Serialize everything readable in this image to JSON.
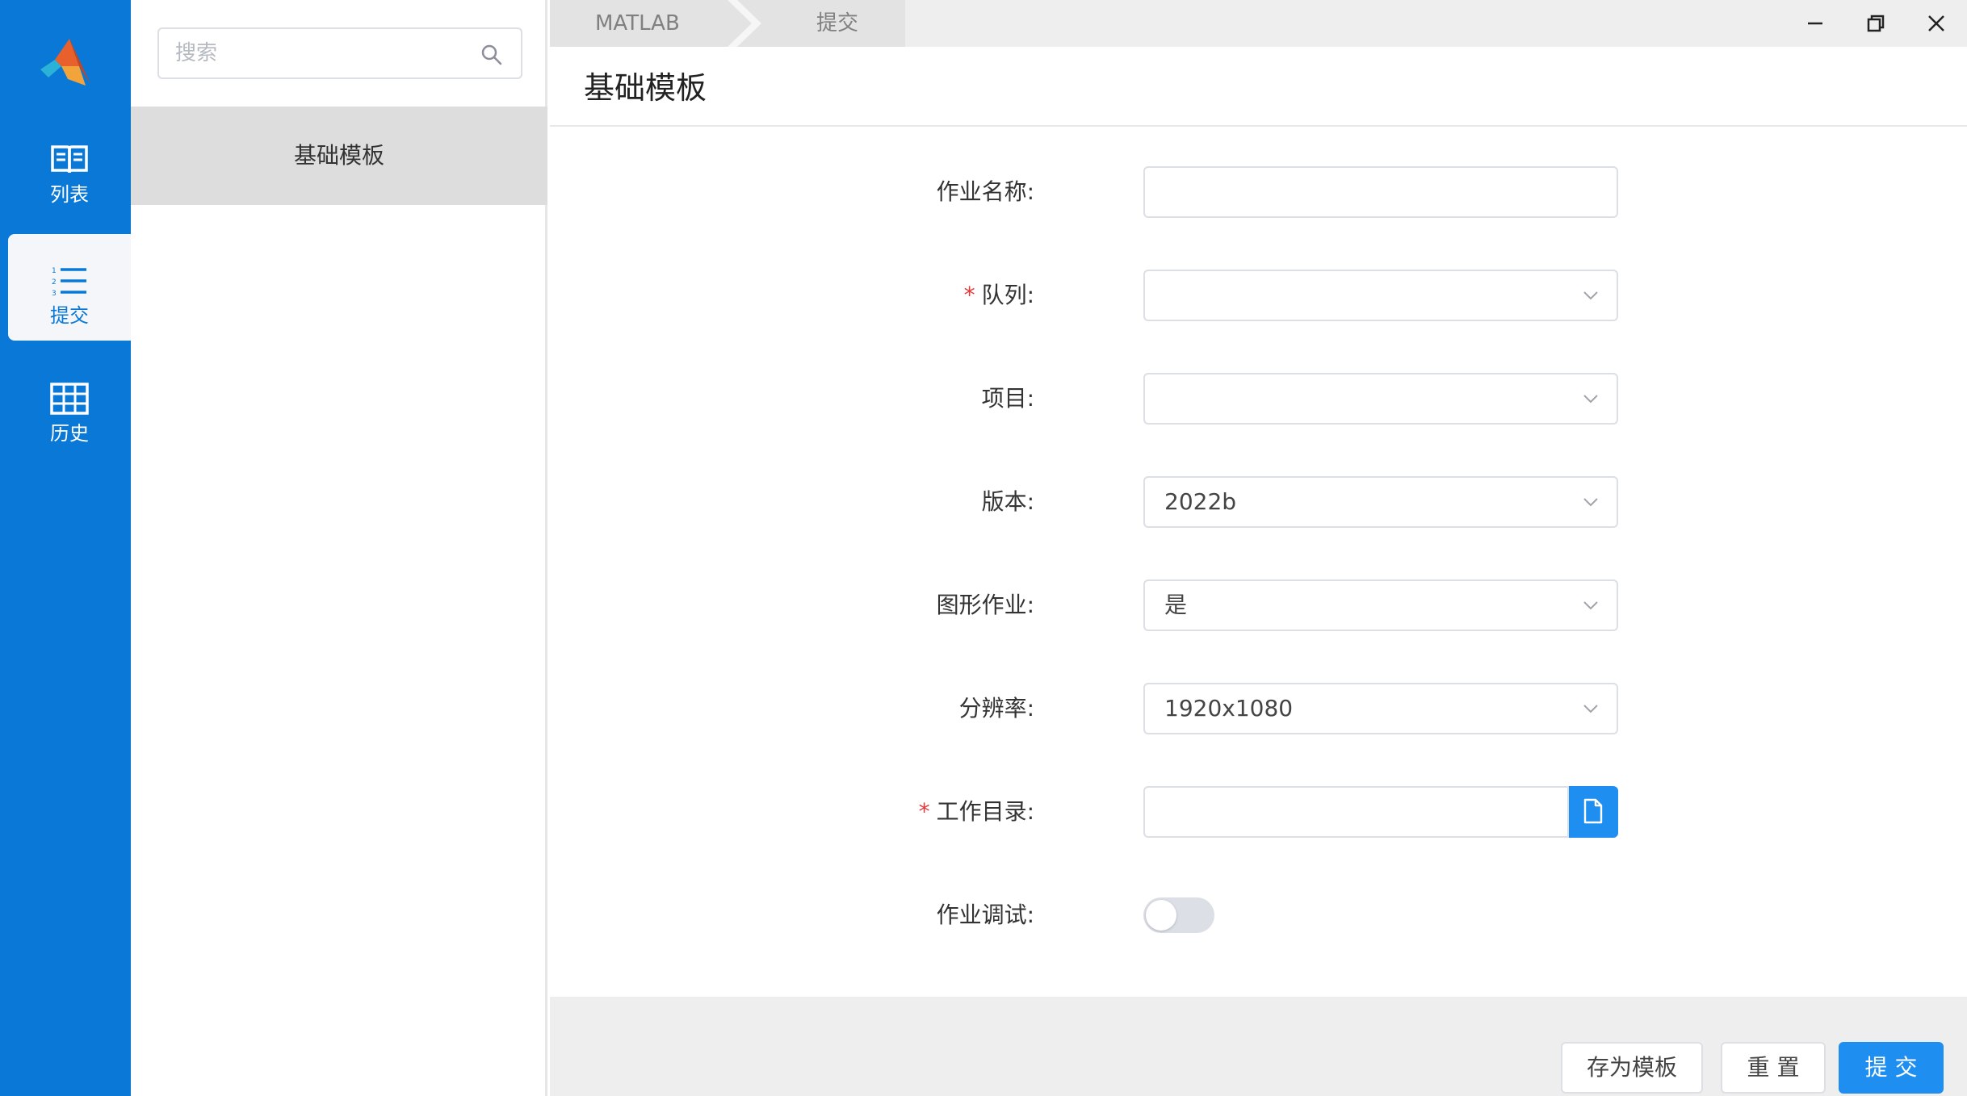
{
  "nav": {
    "items": [
      {
        "label": "列表",
        "icon": "book-icon"
      },
      {
        "label": "提交",
        "icon": "numbered-list-icon"
      },
      {
        "label": "历史",
        "icon": "table-grid-icon"
      }
    ],
    "active": "提交"
  },
  "templates": {
    "search_placeholder": "搜索",
    "items": [
      {
        "label": "基础模板",
        "selected": true
      }
    ]
  },
  "breadcrumb": [
    "MATLAB",
    "提交"
  ],
  "page": {
    "title": "基础模板"
  },
  "form": {
    "job_name": {
      "label": "作业名称:",
      "value": ""
    },
    "queue": {
      "label": "队列:",
      "required": true,
      "value": ""
    },
    "project": {
      "label": "项目:",
      "value": ""
    },
    "version": {
      "label": "版本:",
      "value": "2022b"
    },
    "graphic_job": {
      "label": "图形作业:",
      "value": "是"
    },
    "resolution": {
      "label": "分辨率:",
      "value": "1920x1080"
    },
    "work_dir": {
      "label": "工作目录:",
      "required": true,
      "value": ""
    },
    "job_debug": {
      "label": "作业调试:",
      "enabled": false
    }
  },
  "footer": {
    "save_template": "存为模板",
    "reset": "重 置",
    "submit": "提 交"
  },
  "colors": {
    "nav_bg": "#0a78d7",
    "primary": "#1f8ef1",
    "required": "#e03a3a"
  }
}
